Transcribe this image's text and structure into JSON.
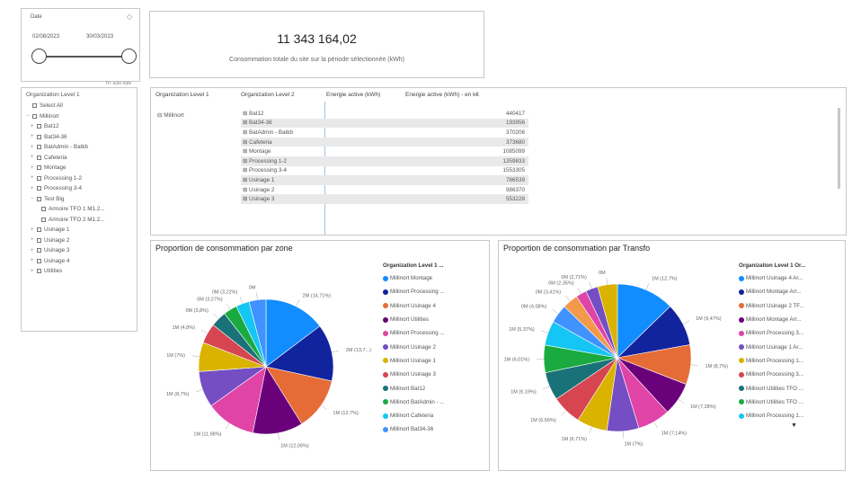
{
  "date_slicer": {
    "title": "Date",
    "start": "02/08/2023",
    "end": "30/03/2023"
  },
  "kpi": {
    "value": "11 343 164,02",
    "label": "Consommation totale du site sur la période sélectionnée (kWh)"
  },
  "filter_tag": "Tri: auto date",
  "org_slicer": {
    "title": "Organization Level 1",
    "items": [
      {
        "label": "Select All",
        "indent": 0,
        "twisty": ""
      },
      {
        "label": "Millinort",
        "indent": 0,
        "twisty": "−"
      },
      {
        "label": "Bat12",
        "indent": 1,
        "twisty": "+"
      },
      {
        "label": "Bat34-36",
        "indent": 1,
        "twisty": "+"
      },
      {
        "label": "BatAdmin - Batkb",
        "indent": 1,
        "twisty": "+"
      },
      {
        "label": "Cafeteria",
        "indent": 1,
        "twisty": "+"
      },
      {
        "label": "Montage",
        "indent": 1,
        "twisty": "+"
      },
      {
        "label": "Processing 1-2",
        "indent": 1,
        "twisty": "+"
      },
      {
        "label": "Processing 3-4",
        "indent": 1,
        "twisty": "+"
      },
      {
        "label": "Test Big",
        "indent": 1,
        "twisty": "−"
      },
      {
        "label": "Armoire TFO 1 M1.2...",
        "indent": 2,
        "twisty": ""
      },
      {
        "label": "Armoire TFO 2 M1.2...",
        "indent": 2,
        "twisty": ""
      },
      {
        "label": "Usinage 1",
        "indent": 1,
        "twisty": "+"
      },
      {
        "label": "Usinage 2",
        "indent": 1,
        "twisty": "+"
      },
      {
        "label": "Usinage 3",
        "indent": 1,
        "twisty": "+"
      },
      {
        "label": "Usinage 4",
        "indent": 1,
        "twisty": "+"
      },
      {
        "label": "Utilities",
        "indent": 1,
        "twisty": "+"
      }
    ]
  },
  "matrix": {
    "headers": [
      "Organization Level 1",
      "Organization Level 2",
      "Energie active (kWh)",
      "Energie active (kWh) - en k€"
    ],
    "level1": "Millinort",
    "rows": [
      {
        "name": "Bat12",
        "value": "440417"
      },
      {
        "name": "Bat34-36",
        "value": "193956"
      },
      {
        "name": "BatAdmin - Batkb",
        "value": "370206"
      },
      {
        "name": "Cafeteria",
        "value": "373680"
      },
      {
        "name": "Montage",
        "value": "1085099"
      },
      {
        "name": "Processing 1-2",
        "value": "1359833"
      },
      {
        "name": "Processing 3-4",
        "value": "1553305"
      },
      {
        "name": "Usinage 1",
        "value": "786539"
      },
      {
        "name": "Usinage 2",
        "value": "986370"
      },
      {
        "name": "Usinage 3",
        "value": "553228"
      }
    ]
  },
  "pie_zone": {
    "title": "Proportion de consommation par zone",
    "legend_title": "Organization Level 1 ...",
    "legend": [
      {
        "label": "Millinort Montage",
        "color": "#118DFF"
      },
      {
        "label": "Millinort Processing ...",
        "color": "#12239E"
      },
      {
        "label": "Millinort Usinage 4",
        "color": "#E66C37"
      },
      {
        "label": "Millinort Utilities",
        "color": "#6B007B"
      },
      {
        "label": "Millinort Processing ...",
        "color": "#E044A7"
      },
      {
        "label": "Millinort Usinage 2",
        "color": "#744EC2"
      },
      {
        "label": "Millinort Usinage 1",
        "color": "#D9B300"
      },
      {
        "label": "Millinort Usinage 3",
        "color": "#D64550"
      },
      {
        "label": "Millinort Bat12",
        "color": "#197278"
      },
      {
        "label": "Millinort BatAdmin - ...",
        "color": "#1AAB40"
      },
      {
        "label": "Millinort Cafeteria",
        "color": "#15C6F4"
      },
      {
        "label": "Millinort Bat34-36",
        "color": "#4092FF"
      }
    ],
    "slices": [
      {
        "value": 14.71,
        "color": "#118DFF",
        "label": "2M (14,71%)"
      },
      {
        "value": 13.7,
        "color": "#12239E",
        "label": "2M (13,7...)"
      },
      {
        "value": 12.7,
        "color": "#E66C37",
        "label": "1M (12,7%)"
      },
      {
        "value": 12.06,
        "color": "#6B007B",
        "label": "1M (12,06%)"
      },
      {
        "value": 11.98,
        "color": "#E044A7",
        "label": "1M (11,98%)"
      },
      {
        "value": 8.7,
        "color": "#744EC2",
        "label": "1M (8,7%)"
      },
      {
        "value": 7.0,
        "color": "#D9B300",
        "label": "1M (7%)"
      },
      {
        "value": 4.8,
        "color": "#D64550",
        "label": "1M (4,8%)"
      },
      {
        "value": 3.8,
        "color": "#197278",
        "label": "0M (3,8%)"
      },
      {
        "value": 3.27,
        "color": "#1AAB40",
        "label": "0M (3,27%)"
      },
      {
        "value": 3.22,
        "color": "#15C6F4",
        "label": "0M (3,22%)"
      },
      {
        "value": 4.06,
        "color": "#4092FF",
        "label": "0M"
      }
    ]
  },
  "pie_transfo": {
    "title": "Proportion de consommation par Transfo",
    "legend_title": "Organization Level 1 Or...",
    "legend": [
      {
        "label": "Millinort Usinage 4 Ar...",
        "color": "#118DFF"
      },
      {
        "label": "Millinort Montage Arr...",
        "color": "#12239E"
      },
      {
        "label": "Millinort Usinage 2 TF...",
        "color": "#E66C37"
      },
      {
        "label": "Millinort Montage Arr...",
        "color": "#6B007B"
      },
      {
        "label": "Millinort Processing 3...",
        "color": "#E044A7"
      },
      {
        "label": "Millinort Usinage 1 Ar...",
        "color": "#744EC2"
      },
      {
        "label": "Millinort Processing 1...",
        "color": "#D9B300"
      },
      {
        "label": "Millinort Processing 3...",
        "color": "#D64550"
      },
      {
        "label": "Millinort Utilities TFO ...",
        "color": "#197278"
      },
      {
        "label": "Millinort Utilities TFO ...",
        "color": "#1AAB40"
      },
      {
        "label": "Millinort Processing 1...",
        "color": "#15C6F4"
      }
    ],
    "slices": [
      {
        "value": 12.7,
        "color": "#118DFF",
        "label": "1M (12,7%)"
      },
      {
        "value": 9.47,
        "color": "#12239E",
        "label": "1M (9,47%)"
      },
      {
        "value": 8.7,
        "color": "#E66C37",
        "label": "1M (8,7%)"
      },
      {
        "value": 7.28,
        "color": "#6B007B",
        "label": "1M (7,28%)"
      },
      {
        "value": 7.14,
        "color": "#E044A7",
        "label": "1M (7,14%)"
      },
      {
        "value": 7.0,
        "color": "#744EC2",
        "label": "1M (7%)"
      },
      {
        "value": 6.71,
        "color": "#D9B300",
        "label": "1M (6,71%)"
      },
      {
        "value": 6.56,
        "color": "#D64550",
        "label": "1M (6,56%)"
      },
      {
        "value": 6.19,
        "color": "#197278",
        "label": "1M (6,19%)"
      },
      {
        "value": 6.01,
        "color": "#1AAB40",
        "label": "1M (6,01%)"
      },
      {
        "value": 5.37,
        "color": "#15C6F4",
        "label": "1M (5,37%)"
      },
      {
        "value": 4.08,
        "color": "#4092FF",
        "label": "0M (4,08%)"
      },
      {
        "value": 3.41,
        "color": "#F2994A",
        "label": "0M (3,41%)"
      },
      {
        "value": 2.35,
        "color": "#E044A7",
        "label": "0M (2,35%)"
      },
      {
        "value": 2.71,
        "color": "#744EC2",
        "label": "0M (2,71%)"
      },
      {
        "value": 4.32,
        "color": "#D9B300",
        "label": "0M"
      }
    ]
  }
}
